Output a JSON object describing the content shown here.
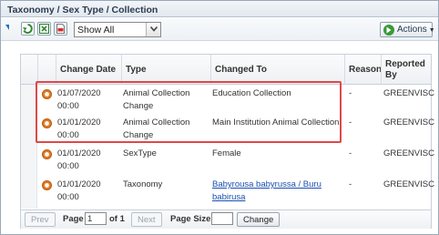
{
  "breadcrumb": "Taxonomy / Sex Type / Collection",
  "toolbar": {
    "filter_value": "Show All",
    "actions_label": "Actions",
    "icons": [
      "refresh-icon",
      "export-excel-icon",
      "export-pdf-icon"
    ]
  },
  "table": {
    "columns": [
      "Change Date",
      "Type",
      "Changed To",
      "Reason",
      "Reported By"
    ],
    "rows": [
      {
        "date": "01/07/2020",
        "time": "00:00",
        "type_l1": "Animal Collection",
        "type_l2": "Change",
        "changed_l1": "Education Collection",
        "changed_l2": "",
        "reason": "-",
        "by": "GREENVISC"
      },
      {
        "date": "01/01/2020",
        "time": "00:00",
        "type_l1": "Animal Collection",
        "type_l2": "Change",
        "changed_l1": "Main Institution Animal Collection",
        "changed_l2": "",
        "reason": "-",
        "by": "GREENVISC"
      },
      {
        "date": "01/01/2020",
        "time": "00:00",
        "type_l1": "SexType",
        "type_l2": "",
        "changed_l1": "Female",
        "changed_l2": "",
        "reason": "-",
        "by": "GREENVISC"
      },
      {
        "date": "01/01/2020",
        "time": "00:00",
        "type_l1": "Taxonomy",
        "type_l2": "",
        "changed_l1": "Babyrousa babyrussa / Buru",
        "changed_l2": "babirusa",
        "reason": "-",
        "by": "GREENVISC"
      }
    ]
  },
  "pager": {
    "prev": "Prev",
    "page_label": "Page",
    "page_value": "1",
    "of_label": "of 1",
    "next": "Next",
    "size_label": "Page Size",
    "size_value": "",
    "change_label": "Change"
  },
  "colors": {
    "highlight": "#e04848",
    "link": "#1a4fb0",
    "row_icon": "#e07b27"
  }
}
